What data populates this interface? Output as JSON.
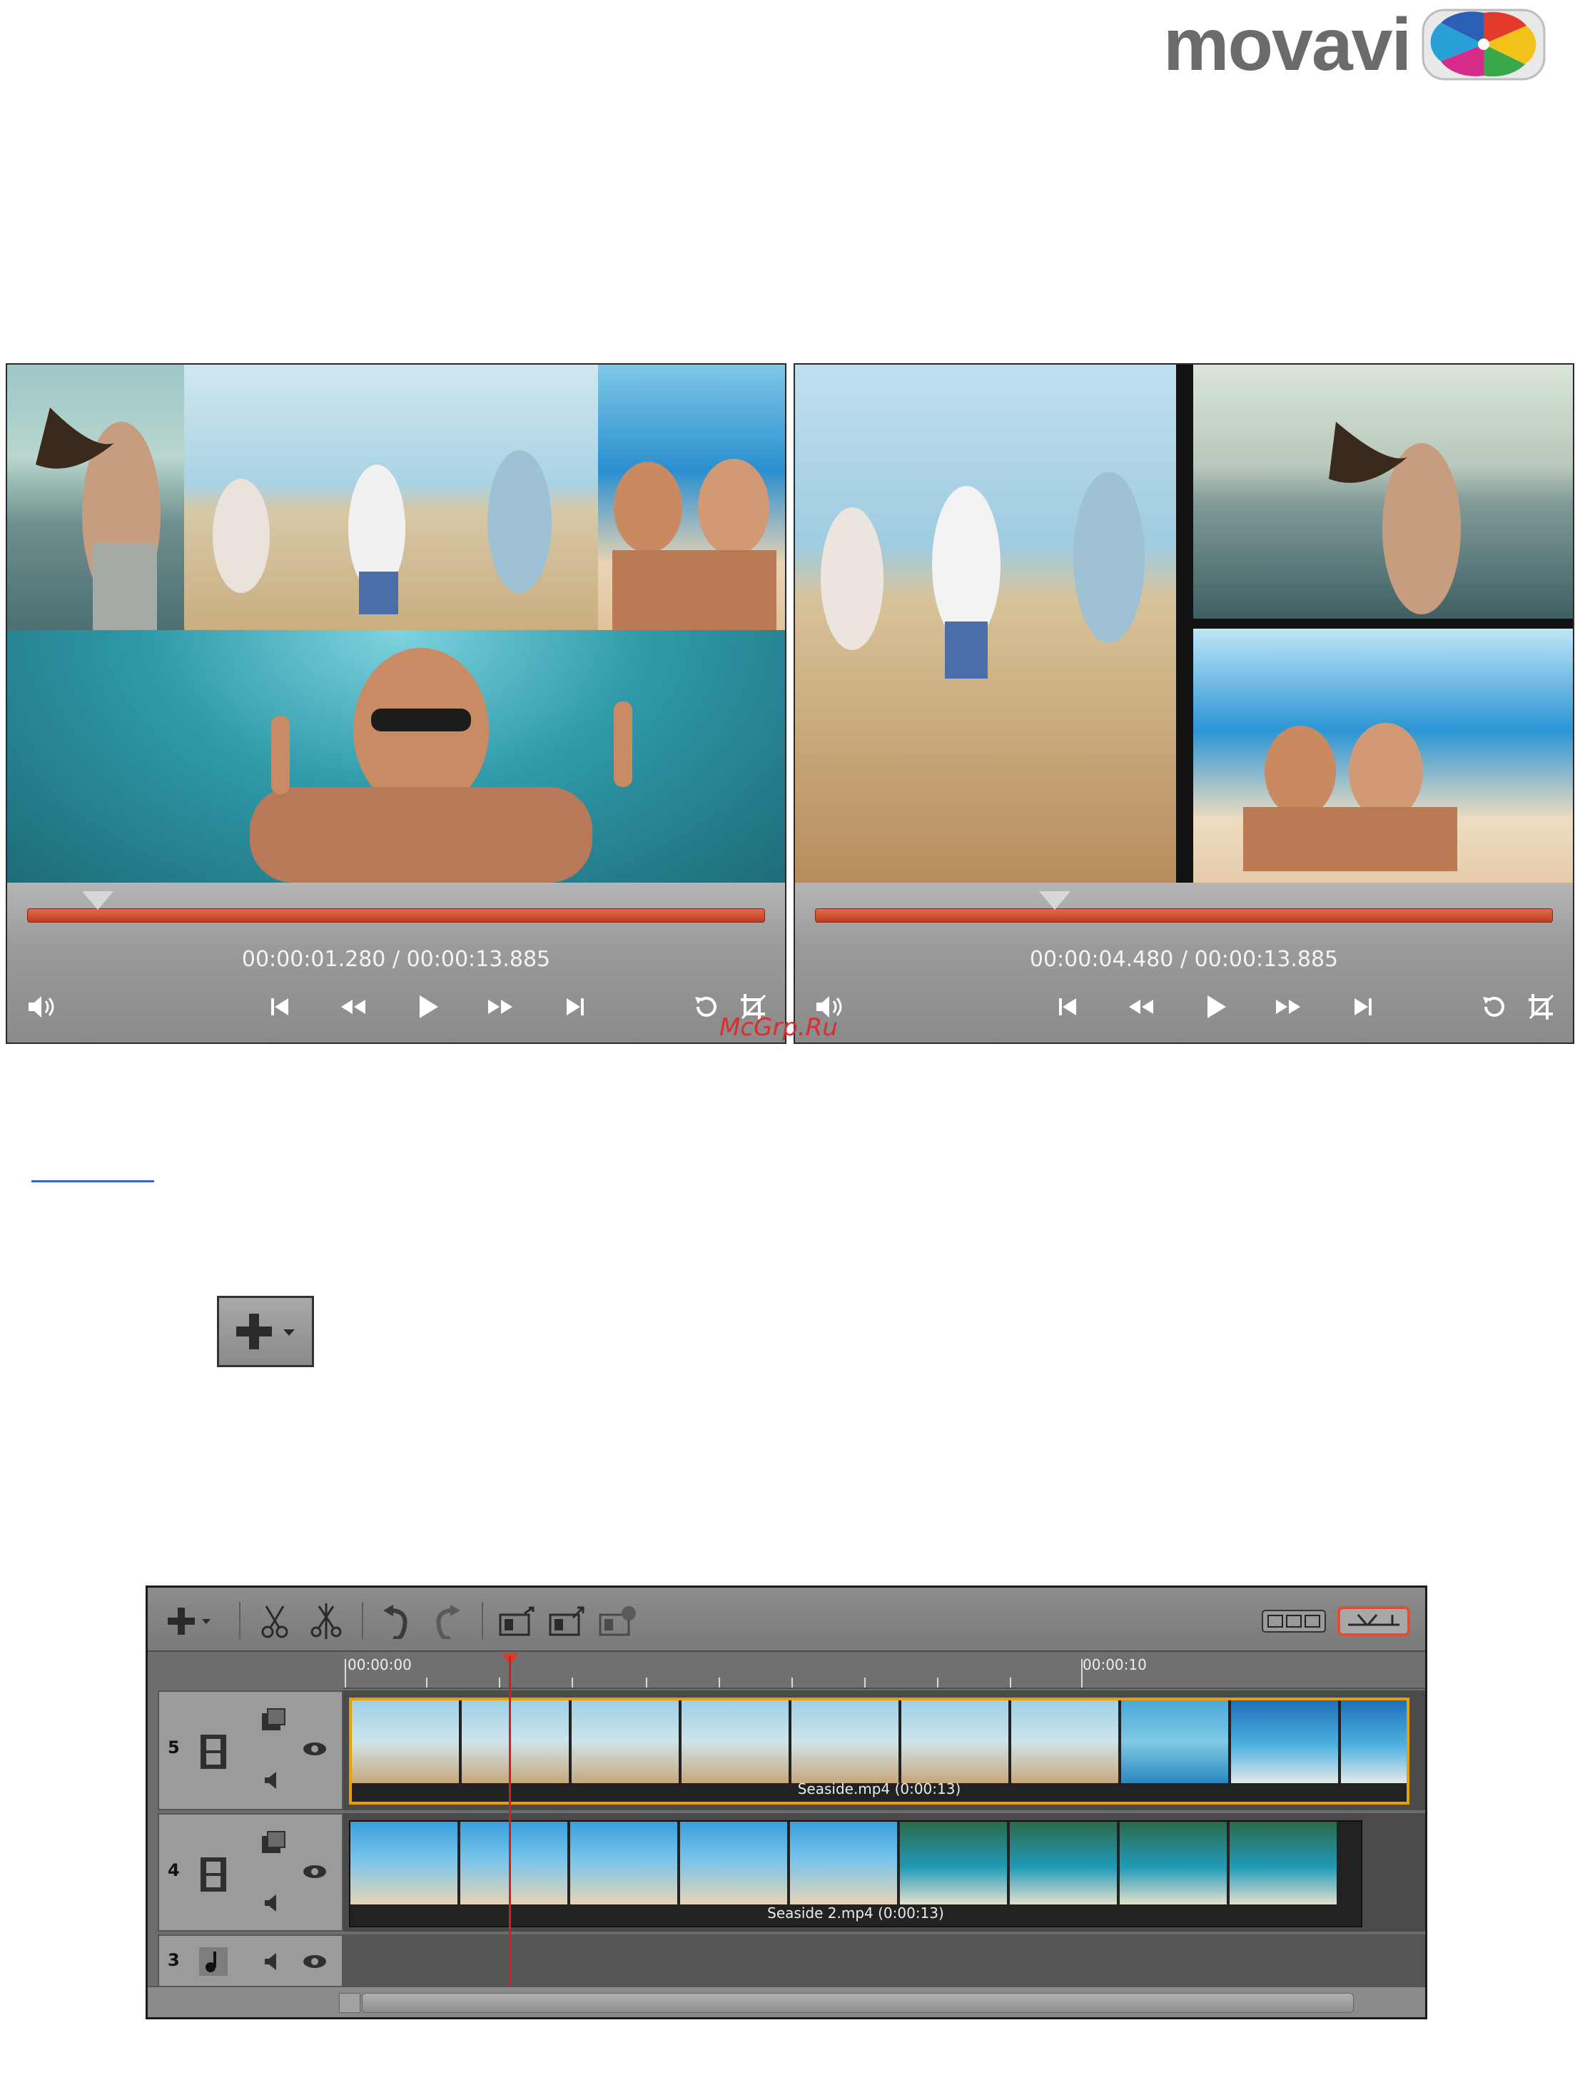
{
  "brand": {
    "wordmark": "movavi",
    "logo_icon": "movavi-pinwheel-icon"
  },
  "player_left": {
    "time_current": "00:00:01.280",
    "time_total": "/ 00:00:13.885",
    "progress": 0.09,
    "icons": [
      "volume-icon",
      "skip-start-icon",
      "rewind-icon",
      "play-icon",
      "fast-forward-icon",
      "skip-end-icon",
      "rotate-icon",
      "crop-icon"
    ]
  },
  "player_right": {
    "time_current": "00:00:04.480",
    "time_total": "/ 00:00:13.885",
    "progress": 0.32,
    "icons": [
      "volume-icon",
      "skip-start-icon",
      "rewind-icon",
      "play-icon",
      "fast-forward-icon",
      "skip-end-icon",
      "rotate-icon",
      "crop-icon"
    ]
  },
  "watermark": "McGrp.Ru",
  "add_button_icon": "add-plus-dropdown-icon",
  "timeline": {
    "ruler": {
      "start": "00:00:00",
      "mark": "00:00:10"
    },
    "tracks": [
      {
        "number": "5",
        "type": "video",
        "clip": "Seaside.mp4 (0:00:13)",
        "selected": true
      },
      {
        "number": "4",
        "type": "video",
        "clip": "Seaside 2.mp4 (0:00:13)",
        "selected": false
      },
      {
        "number": "3",
        "type": "audio",
        "clip": "",
        "selected": false
      }
    ]
  },
  "colors": {
    "seek_bar": "#d4482c",
    "playhead": "#d02020",
    "selection": "#e8a000"
  }
}
